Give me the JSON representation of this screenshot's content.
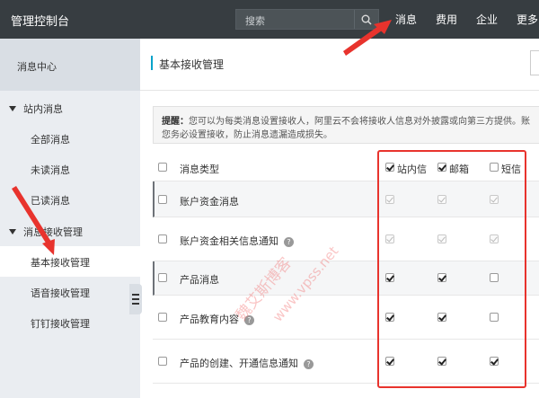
{
  "header": {
    "brand": "管理控制台",
    "search_placeholder": "搜索",
    "nav": [
      "消息",
      "费用",
      "企业",
      "更多"
    ]
  },
  "sidebar": {
    "title": "消息中心",
    "groups": [
      {
        "label": "站内消息",
        "items": [
          "全部消息",
          "未读消息",
          "已读消息"
        ]
      },
      {
        "label": "消息接收管理",
        "items": [
          "基本接收管理",
          "语音接收管理",
          "钉钉接收管理"
        ]
      }
    ],
    "active_item": "基本接收管理"
  },
  "main": {
    "title": "基本接收管理",
    "tip_label": "提醒：",
    "tip_line1": "您可以为每类消息设置接收人，阿里云不会将接收人信息对外披露或向第三方提供。账",
    "tip_line2": "您务必设置接收，防止消息遗漏造成损失。"
  },
  "table": {
    "header": {
      "type_label": "消息类型",
      "channels": [
        "站内信",
        "邮箱",
        "短信"
      ],
      "channel_checked": [
        true,
        true,
        false
      ]
    },
    "rows": [
      {
        "name": "账户资金消息",
        "help": false,
        "checks": [
          "disabled",
          "disabled",
          "disabled"
        ]
      },
      {
        "name": "账户资金相关信息通知",
        "help": true,
        "checks": [
          "disabled",
          "disabled",
          "disabled"
        ]
      },
      {
        "name": "产品消息",
        "help": false,
        "checks": [
          "on",
          "on",
          "off"
        ]
      },
      {
        "name": "产品教育内容",
        "help": true,
        "checks": [
          "on",
          "on",
          "off"
        ]
      },
      {
        "name": "产品的创建、开通信息通知",
        "help": true,
        "checks": [
          "on",
          "on",
          "on"
        ]
      }
    ]
  },
  "watermark": [
    "魏艾斯博客",
    "www.vpss.net"
  ],
  "colors": {
    "topbar": "#373d41",
    "sidebar": "#eaedf1",
    "accent": "#00a2ca",
    "annotation": "#e8332d"
  }
}
